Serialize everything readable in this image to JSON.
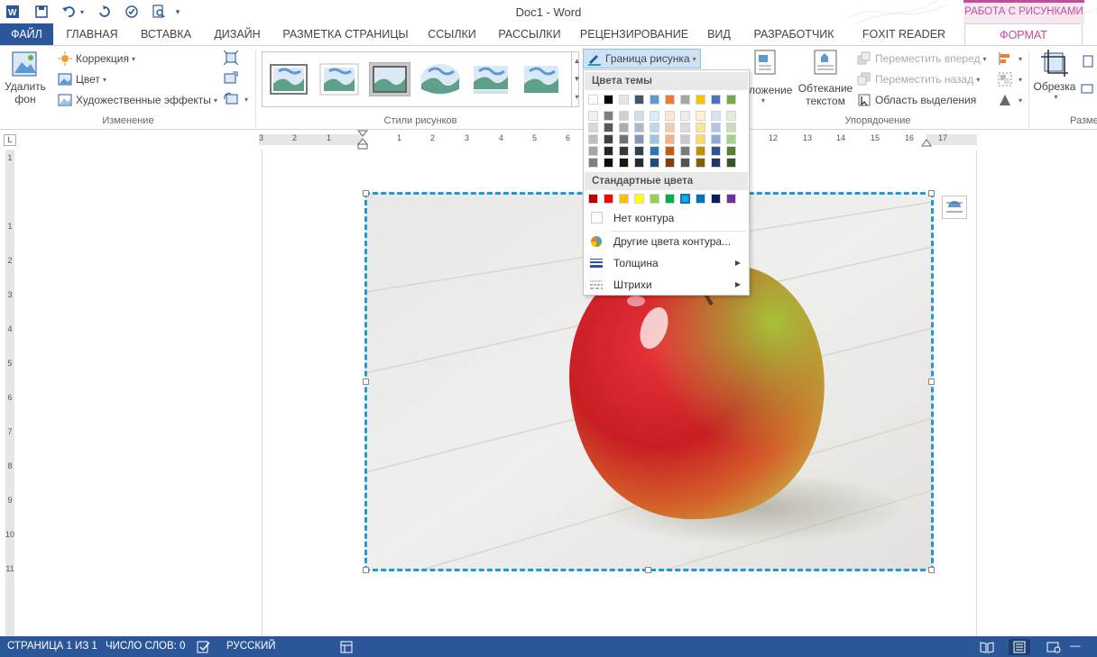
{
  "window": {
    "title": "Doc1 - Word"
  },
  "context_group": "РАБОТА С РИСУНКАМИ",
  "tabs": [
    "ФАЙЛ",
    "ГЛАВНАЯ",
    "ВСТАВКА",
    "ДИЗАЙН",
    "РАЗМЕТКА СТРАНИЦЫ",
    "ССЫЛКИ",
    "РАССЫЛКИ",
    "РЕЦЕНЗИРОВАНИЕ",
    "ВИД",
    "РАЗРАБОТЧИК",
    "FOXIT READER PDF",
    "ФОРМАТ"
  ],
  "active_tab": "ФОРМАТ",
  "ribbon": {
    "remove_bg": {
      "line1": "Удалить",
      "line2": "фон"
    },
    "correction": "Коррекция",
    "color": "Цвет",
    "art_effects": "Художественные эффекты",
    "group_change": "Изменение",
    "group_styles": "Стили рисунков",
    "picture_border": "Граница рисунка",
    "position": "ложение",
    "wrap_text": {
      "line1": "Обтекание",
      "line2": "текстом"
    },
    "bring_forward": "Переместить вперед",
    "send_backward": "Переместить назад",
    "selection_pane": "Область выделения",
    "group_arrange": "Упорядочение",
    "crop": "Обрезка",
    "group_size": "Разме"
  },
  "ruler": {
    "h_numbers": [
      "3",
      "2",
      "1",
      "1",
      "2",
      "3",
      "4",
      "5",
      "6",
      "12",
      "13",
      "14",
      "15",
      "16",
      "17"
    ],
    "v_numbers": [
      "1",
      "1",
      "2",
      "3",
      "4",
      "5",
      "6",
      "7",
      "8",
      "9",
      "10",
      "11"
    ]
  },
  "dropdown": {
    "theme_colors_header": "Цвета темы",
    "standard_colors_header": "Стандартные цвета",
    "theme_colors": [
      "#ffffff",
      "#000000",
      "#e7e6e6",
      "#44546a",
      "#5b9bd5",
      "#ed7d31",
      "#a5a5a5",
      "#ffc000",
      "#4472c4",
      "#70ad47"
    ],
    "theme_tints": [
      [
        "#f2f2f2",
        "#7f7f7f",
        "#d0cece",
        "#d6dce4",
        "#deebf6",
        "#fbe5d5",
        "#ededed",
        "#fff2cc",
        "#dae3f3",
        "#e2efd9"
      ],
      [
        "#d8d8d8",
        "#595959",
        "#aeabab",
        "#adb9ca",
        "#bdd7ee",
        "#f7cbac",
        "#dbdbdb",
        "#fee599",
        "#b4c6e7",
        "#c5e0b3"
      ],
      [
        "#bfbfbf",
        "#3f3f3f",
        "#757070",
        "#8496b0",
        "#9dc3e6",
        "#f4b183",
        "#c9c9c9",
        "#ffd965",
        "#8eaadb",
        "#a8d08d"
      ],
      [
        "#a5a5a5",
        "#262626",
        "#3a3838",
        "#323f4f",
        "#2e75b5",
        "#c55a11",
        "#7b7b7b",
        "#bf9000",
        "#2f5496",
        "#538135"
      ],
      [
        "#7f7f7f",
        "#0c0c0c",
        "#171616",
        "#222a35",
        "#1e4e79",
        "#833c0b",
        "#525252",
        "#7f6000",
        "#1f3864",
        "#375623"
      ]
    ],
    "standard_colors": [
      "#c00000",
      "#ff0000",
      "#ffc000",
      "#ffff00",
      "#92d050",
      "#00b050",
      "#00b0f0",
      "#0070c0",
      "#002060",
      "#7030a0"
    ],
    "selected_standard": 6,
    "no_outline": "Нет контура",
    "more_colors": "Другие цвета контура...",
    "weight": "Толщина",
    "dashes": "Штрихи"
  },
  "statusbar": {
    "page": "СТРАНИЦА 1 ИЗ 1",
    "words": "ЧИСЛО СЛОВ: 0",
    "language": "РУССКИЙ"
  },
  "colors": {
    "accent": "#2b579a",
    "context": "#c14d9a",
    "picture_border": "#1e9ad6"
  }
}
